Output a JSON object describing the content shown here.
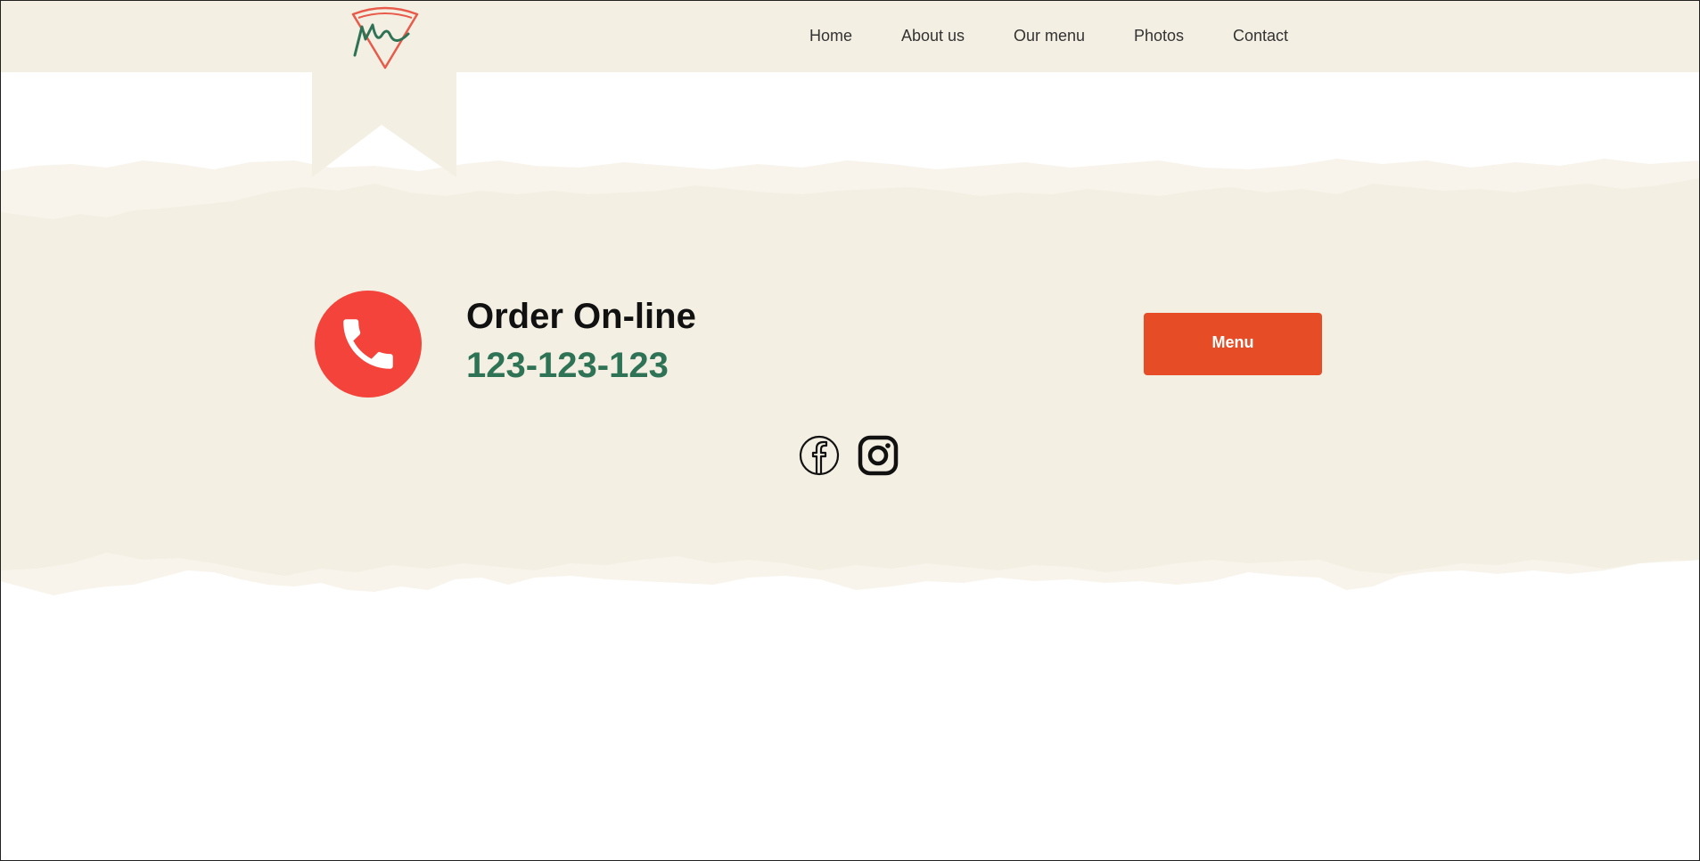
{
  "nav": {
    "items": [
      {
        "label": "Home"
      },
      {
        "label": "About us"
      },
      {
        "label": "Our menu"
      },
      {
        "label": "Photos"
      },
      {
        "label": "Contact"
      }
    ]
  },
  "order": {
    "title": "Order On-line",
    "phone": "123-123-123",
    "menu_button": "Menu"
  },
  "icons": {
    "logo": "pizza-slice-logo-icon",
    "phone": "phone-icon",
    "facebook": "facebook-icon",
    "instagram": "instagram-icon"
  },
  "colors": {
    "beige": "#f4efe3",
    "accent_red": "#f4433a",
    "button_orange": "#e64d27",
    "phone_green": "#2e7355"
  }
}
